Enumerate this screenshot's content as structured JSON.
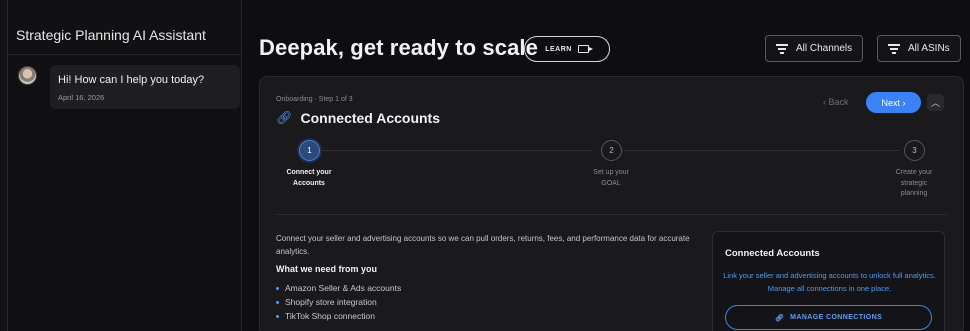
{
  "sidebar": {
    "title": "Strategic Planning AI Assistant",
    "chat": {
      "title": "Hi! How can I help you today?",
      "date": "April 16, 2026"
    }
  },
  "header": {
    "headline": "Deepak, get ready to scale",
    "learn_label": "LEARN",
    "channels_label": "All Channels",
    "asins_label": "All ASINs"
  },
  "onboarding": {
    "step_label": "Onboarding · Step 1 of 3",
    "title": "Connected Accounts",
    "back_label": "‹ Back",
    "next_label": "Next ›",
    "steps": [
      {
        "number": "1",
        "line1": "Connect your",
        "line2": "Accounts",
        "line3": ""
      },
      {
        "number": "2",
        "line1": "Set up your",
        "line2": "GOAL",
        "line3": ""
      },
      {
        "number": "3",
        "line1": "Create your",
        "line2": "strategic",
        "line3": "planning"
      }
    ],
    "intro": "Connect your seller and advertising accounts so we can pull orders, returns, fees, and performance data for accurate analytics.",
    "need_title": "What we need from you",
    "needs": [
      "Amazon Seller & Ads accounts",
      "Shopify store integration",
      "TikTok Shop connection"
    ],
    "panel": {
      "title": "Connected Accounts",
      "description": "Link your seller and advertising accounts to unlock full analytics. Manage all connections in one place.",
      "manage_label": "MANAGE CONNECTIONS"
    }
  },
  "colors": {
    "accent": "#3b82f6",
    "background": "#0e0e10",
    "card": "#1a1a1d"
  }
}
